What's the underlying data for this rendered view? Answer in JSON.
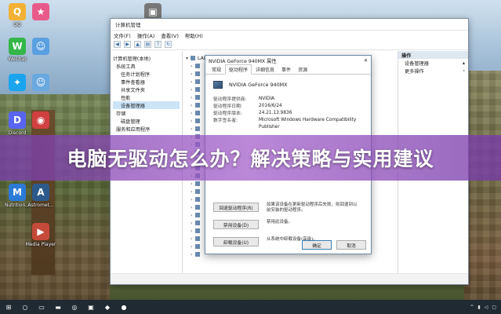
{
  "desktop": {
    "icons": [
      {
        "label": "QQ",
        "glyph": "Q",
        "color": "#f2b134"
      },
      {
        "label": "",
        "glyph": "★",
        "color": "#e85a8a"
      },
      {
        "label": "",
        "glyph": "▣",
        "color": "#777777"
      },
      {
        "label": "WeChat",
        "glyph": "W",
        "color": "#34b649"
      },
      {
        "label": "",
        "glyph": "☺",
        "color": "#5aa0e0"
      },
      {
        "label": "",
        "glyph": "✦",
        "color": "#1aa4ee"
      },
      {
        "label": "",
        "glyph": "☺",
        "color": "#6aa8e0"
      },
      {
        "label": "Discord",
        "glyph": "D",
        "color": "#5865f2"
      },
      {
        "label": "",
        "glyph": "◉",
        "color": "#d04040"
      },
      {
        "label": "Nutrition...",
        "glyph": "M",
        "color": "#2a7ad6"
      },
      {
        "label": "Astromet...",
        "glyph": "A",
        "color": "#2d5a8a"
      },
      {
        "label": "Media Player",
        "glyph": "▶",
        "color": "#c44a3a"
      }
    ]
  },
  "window": {
    "title": "计算机管理",
    "menu": [
      "文件(F)",
      "操作(A)",
      "查看(V)",
      "帮助(H)"
    ],
    "tree": [
      "计算机管理(本地)",
      "系统工具",
      "任务计划程序",
      "事件查看器",
      "共享文件夹",
      "性能",
      "设备管理器",
      "存储",
      "磁盘管理",
      "服务和应用程序"
    ],
    "device_root": "LAPTOP",
    "actions_header": "操作",
    "actions": [
      "设备管理器",
      "更多操作"
    ]
  },
  "dialog": {
    "title": "NVIDIA GeForce 940MX 属性",
    "tabs": [
      "常规",
      "驱动程序",
      "详细信息",
      "事件",
      "资源"
    ],
    "device_name": "NVIDIA GeForce 940MX",
    "fields": [
      {
        "k": "驱动程序提供商:",
        "v": "NVIDIA"
      },
      {
        "k": "驱动程序日期:",
        "v": "2016/6/24"
      },
      {
        "k": "驱动程序版本:",
        "v": "24.21.13.9836"
      },
      {
        "k": "数字签名者:",
        "v": "Microsoft Windows Hardware Compatibility"
      },
      {
        "k": "",
        "v": "Publisher"
      }
    ],
    "buttons": [
      {
        "label": "回退驱动程序(R)",
        "desc": "如果该设备在更新驱动程序后失败，则回退到以前安装的驱动程序。"
      },
      {
        "label": "禁用设备(D)",
        "desc": "禁用此设备。"
      },
      {
        "label": "卸载设备(U)",
        "desc": "从系统中卸载设备(高级)。"
      }
    ],
    "ok": "确定",
    "cancel": "取消"
  },
  "banner": {
    "text": "电脑无驱动怎么办？解决策略与实用建议"
  }
}
